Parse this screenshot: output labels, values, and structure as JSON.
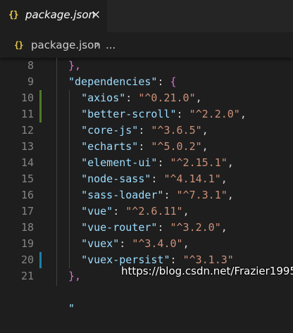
{
  "tab": {
    "icon": "json-braces-icon",
    "icon_glyph": "{}",
    "label": "package.json",
    "close_glyph": "×"
  },
  "breadcrumb": {
    "icon_glyph": "{}",
    "file": "package.json",
    "separator": "›",
    "ellipsis": "..."
  },
  "colors": {
    "background": "#1e1e1e",
    "key": "#9cdcfe",
    "string": "#ce9178",
    "line_number": "#858585",
    "modified_gutter": "#4f7a28",
    "added_gutter": "#1b81a8"
  },
  "lines": [
    {
      "num": "8",
      "indent": "",
      "key": "",
      "value": "",
      "close": "},",
      "open": ""
    },
    {
      "num": "9",
      "indent": "",
      "key": "\"dependencies\"",
      "value": "",
      "close": "",
      "open": "{"
    },
    {
      "num": "10",
      "indent": "  ",
      "key": "\"axios\"",
      "value": "\"^0.21.0\"",
      "close": ",",
      "open": ""
    },
    {
      "num": "11",
      "indent": "  ",
      "key": "\"better-scroll\"",
      "value": "\"^2.2.0\"",
      "close": ",",
      "open": ""
    },
    {
      "num": "12",
      "indent": "  ",
      "key": "\"core-js\"",
      "value": "\"^3.6.5\"",
      "close": ",",
      "open": ""
    },
    {
      "num": "13",
      "indent": "  ",
      "key": "\"echarts\"",
      "value": "\"^5.0.2\"",
      "close": ",",
      "open": ""
    },
    {
      "num": "14",
      "indent": "  ",
      "key": "\"element-ui\"",
      "value": "\"^2.15.1\"",
      "close": ",",
      "open": ""
    },
    {
      "num": "15",
      "indent": "  ",
      "key": "\"node-sass\"",
      "value": "\"^4.14.1\"",
      "close": ",",
      "open": ""
    },
    {
      "num": "16",
      "indent": "  ",
      "key": "\"sass-loader\"",
      "value": "\"^7.3.1\"",
      "close": ",",
      "open": ""
    },
    {
      "num": "17",
      "indent": "  ",
      "key": "\"vue\"",
      "value": "\"^2.6.11\"",
      "close": ",",
      "open": ""
    },
    {
      "num": "18",
      "indent": "  ",
      "key": "\"vue-router\"",
      "value": "\"^3.2.0\"",
      "close": ",",
      "open": ""
    },
    {
      "num": "19",
      "indent": "  ",
      "key": "\"vuex\"",
      "value": "\"^3.4.0\"",
      "close": ",",
      "open": ""
    },
    {
      "num": "20",
      "indent": "  ",
      "key": "\"vuex-persist\"",
      "value": "\"^3.1.3\"",
      "close": "",
      "open": ""
    },
    {
      "num": "21",
      "indent": "",
      "key": "",
      "value": "",
      "close": "},",
      "open": ""
    }
  ],
  "watermark": "https://blog.csdn.net/Frazier1995"
}
